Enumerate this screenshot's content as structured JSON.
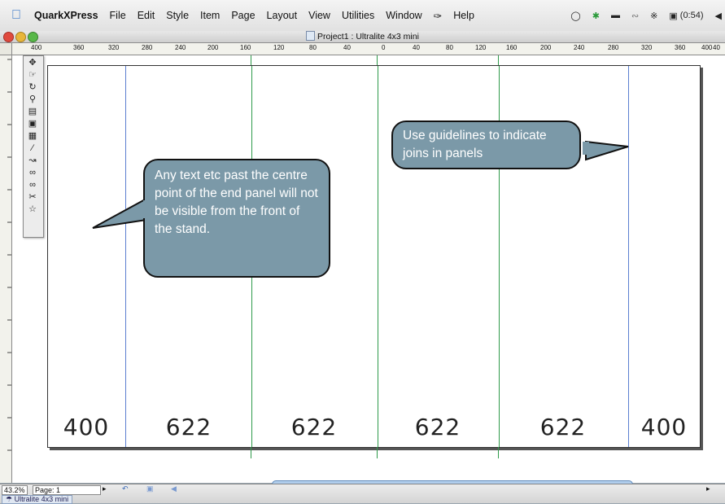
{
  "menubar": {
    "app_name": "QuarkXPress",
    "items": [
      "File",
      "Edit",
      "Style",
      "Item",
      "Page",
      "Layout",
      "View",
      "Utilities",
      "Window",
      "Help"
    ],
    "status": {
      "battery": "(0:54)"
    }
  },
  "window": {
    "title": "Project1 : Ultralite 4x3 mini"
  },
  "ruler": {
    "ticks": [
      "400",
      "360",
      "320",
      "280",
      "240",
      "200",
      "160",
      "120",
      "80",
      "40",
      "0",
      "40",
      "80",
      "120",
      "160",
      "200",
      "240",
      "280",
      "320",
      "360",
      "400"
    ],
    "end_label": "40"
  },
  "panels": [
    "400",
    "622",
    "622",
    "622",
    "622",
    "400"
  ],
  "callouts": {
    "guidelines": "Use guidelines to indicate joins in panels",
    "centre_point": "Any text etc past the centre point of the end panel will not be visible from the front of the stand."
  },
  "statusbar": {
    "zoom": "43.2%",
    "page": "Page: 1"
  },
  "layout_tab": "Ultralite 4x3 mini",
  "colors": {
    "guide_blue": "#5b7fd0",
    "guide_green": "#2e9a4a",
    "bubble": "#7b99a8"
  }
}
